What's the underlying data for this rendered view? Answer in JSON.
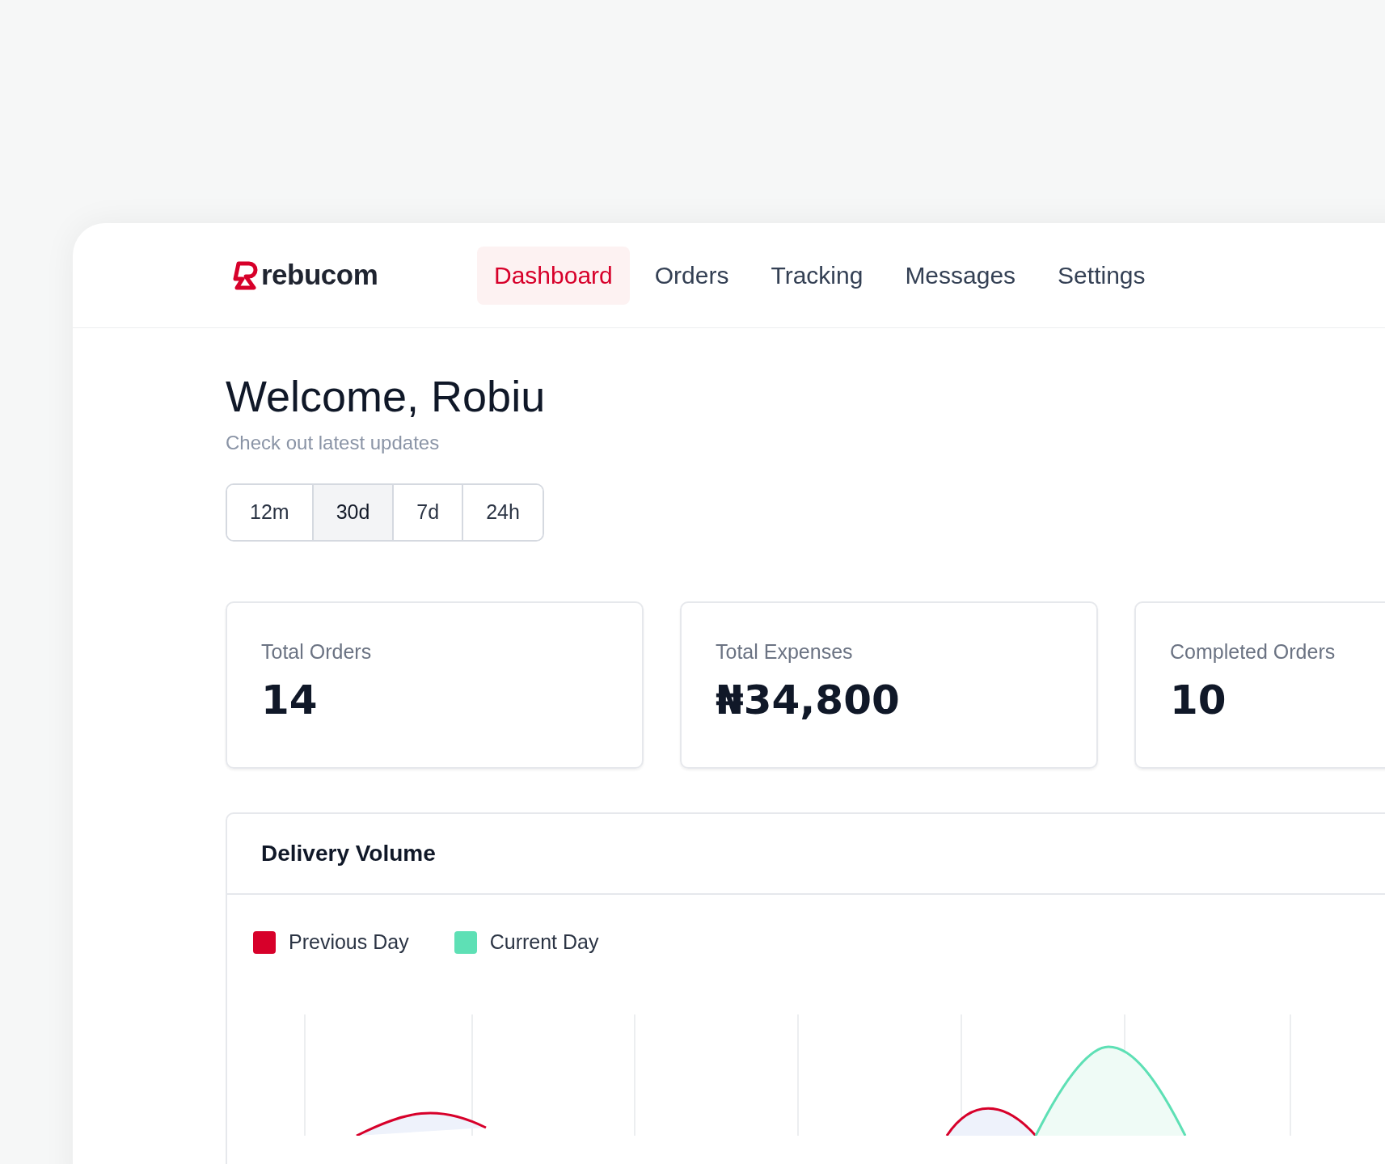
{
  "brand": {
    "name": "rebucom"
  },
  "nav": [
    {
      "label": "Dashboard",
      "selected": true
    },
    {
      "label": "Orders",
      "selected": false
    },
    {
      "label": "Tracking",
      "selected": false
    },
    {
      "label": "Messages",
      "selected": false
    },
    {
      "label": "Settings",
      "selected": false
    }
  ],
  "greeting": {
    "title": "Welcome, Robiu",
    "subtitle": "Check out latest updates"
  },
  "ranges": [
    {
      "label": "12m",
      "selected": false
    },
    {
      "label": "30d",
      "selected": true
    },
    {
      "label": "7d",
      "selected": false
    },
    {
      "label": "24h",
      "selected": false
    }
  ],
  "stats": [
    {
      "label": "Total Orders",
      "value": "14"
    },
    {
      "label": "Total Expenses",
      "value": "₦34,800"
    },
    {
      "label": "Completed Orders",
      "value": "10"
    }
  ],
  "delivery_volume": {
    "title": "Delivery Volume",
    "legend": [
      {
        "label": "Previous Day",
        "color": "#d7002a"
      },
      {
        "label": "Current Day",
        "color": "#5ee0b5"
      }
    ]
  }
}
